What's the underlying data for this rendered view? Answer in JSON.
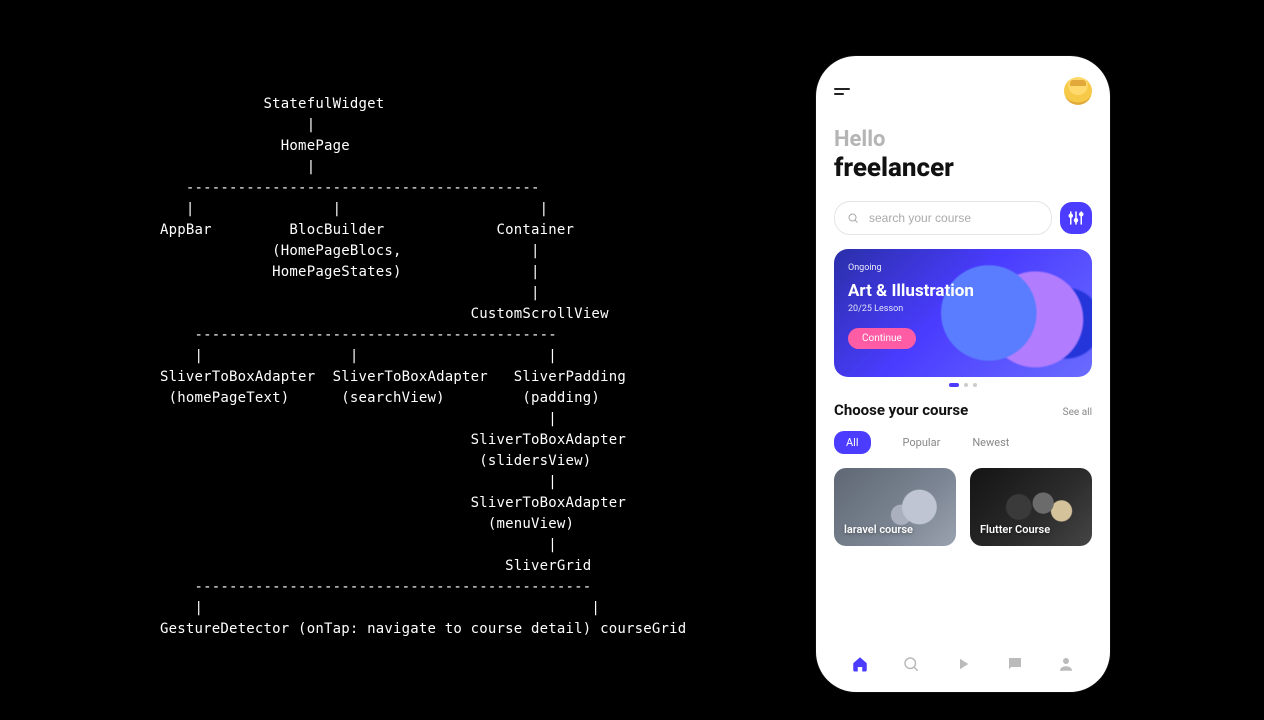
{
  "tree": "            StatefulWidget\n                 |\n              HomePage\n                 |\n   -----------------------------------------\n   |                |                       |\nAppBar         BlocBuilder             Container\n             (HomePageBlocs,               |\n             HomePageStates)               |\n                                           |\n                                    CustomScrollView\n    ------------------------------------------\n    |                 |                      |\nSliverToBoxAdapter  SliverToBoxAdapter   SliverPadding\n (homePageText)      (searchView)         (padding)\n                                             |\n                                    SliverToBoxAdapter\n                                     (slidersView)\n                                             |\n                                    SliverToBoxAdapter\n                                      (menuView)\n                                             |\n                                        SliverGrid\n    ----------------------------------------------\n    |                                             |\nGestureDetector (onTap: navigate to course detail) courseGrid",
  "greeting": {
    "hello": "Hello",
    "name": "freelancer"
  },
  "search": {
    "placeholder": "search your course"
  },
  "hero": {
    "tag": "Ongoing",
    "title": "Art & Illustration",
    "lesson": "20/25 Lesson",
    "button": "Continue"
  },
  "section": {
    "title": "Choose your course",
    "see_all": "See all"
  },
  "chips": [
    "All",
    "Popular",
    "Newest"
  ],
  "cards": [
    {
      "label": "laravel course"
    },
    {
      "label": "Flutter Course"
    }
  ]
}
